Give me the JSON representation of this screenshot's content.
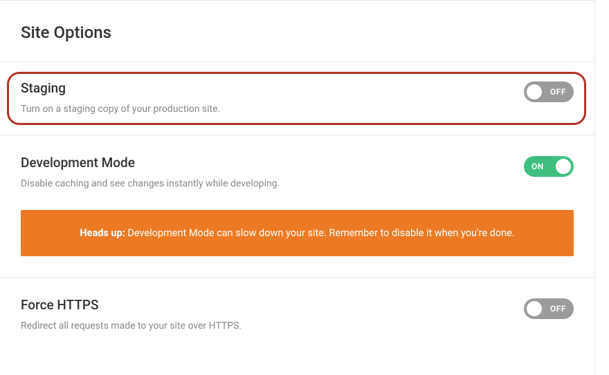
{
  "header": {
    "title": "Site Options"
  },
  "staging": {
    "title": "Staging",
    "description": "Turn on a staging copy of your production site.",
    "toggle_state": "OFF"
  },
  "development": {
    "title": "Development Mode",
    "description": "Disable caching and see changes instantly while developing.",
    "toggle_state": "ON",
    "alert_bold": "Heads up:",
    "alert_text": " Development Mode can slow down your site. Remember to disable it when you're done."
  },
  "force_https": {
    "title": "Force HTTPS",
    "description": "Redirect all requests made to your site over HTTPS.",
    "toggle_state": "OFF"
  }
}
